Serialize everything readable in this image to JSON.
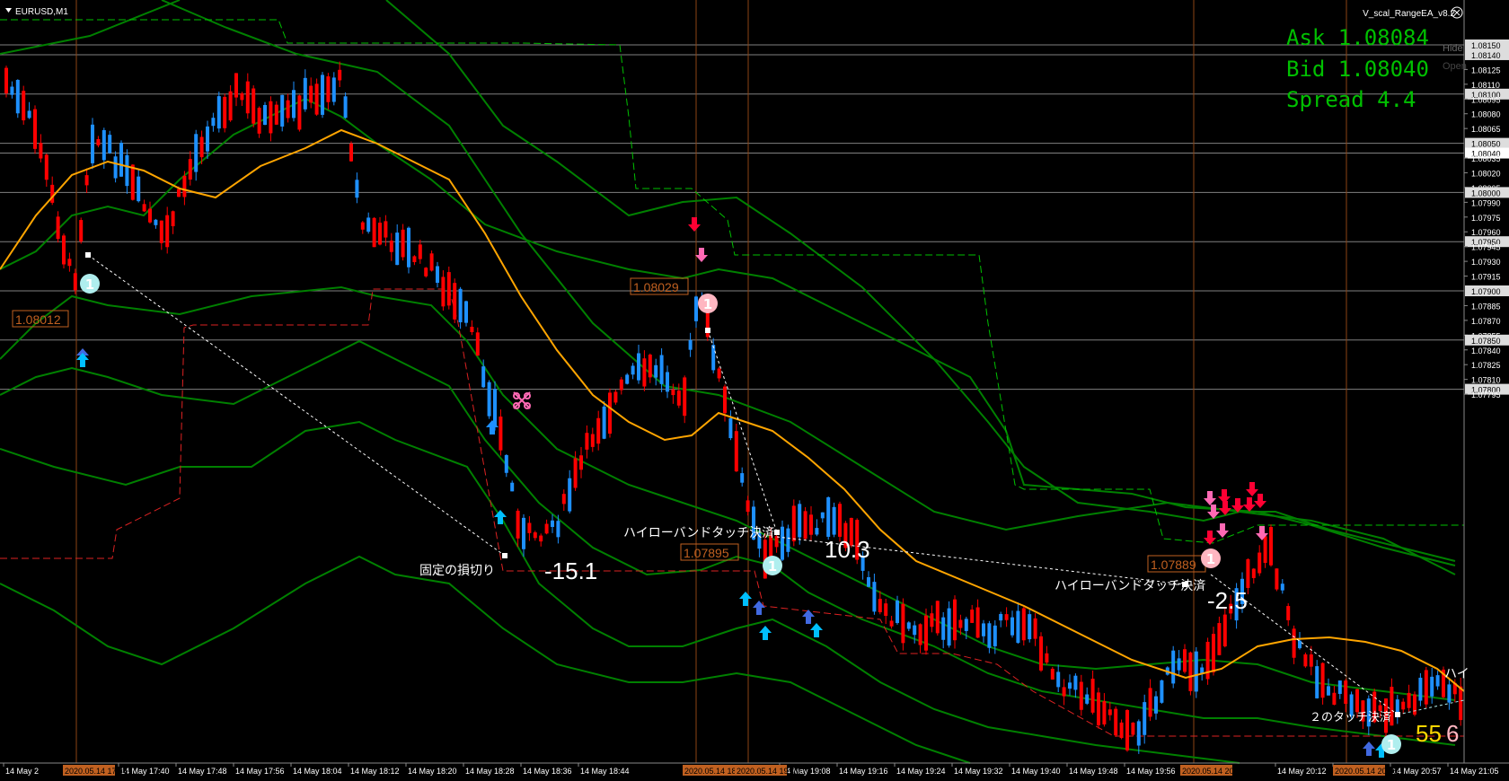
{
  "window": {
    "symbol_title": "EURUSD,M1",
    "ea_label": "V_scal_RangeEA_v8.2"
  },
  "chart_data": {
    "type": "candlestick",
    "symbol": "EURUSD",
    "timeframe": "M1",
    "ylim": [
      1.0779,
      1.0816
    ],
    "price_ticks": [
      "1.08150",
      "1.08140",
      "1.08125",
      "1.08110",
      "1.08100",
      "1.08095",
      "1.08080",
      "1.08065",
      "1.08050",
      "1.08040",
      "1.08035",
      "1.08020",
      "1.08005",
      "1.08000",
      "1.07990",
      "1.07975",
      "1.07960",
      "1.07950",
      "1.07945",
      "1.07930",
      "1.07915",
      "1.07900",
      "1.07885",
      "1.07870",
      "1.07855",
      "1.07850",
      "1.07840",
      "1.07825",
      "1.07810",
      "1.07800",
      "1.07795"
    ],
    "highlighted_ticks": [
      "1.08150",
      "1.08140",
      "1.08100",
      "1.08050",
      "1.08040",
      "1.08000",
      "1.07950",
      "1.07900",
      "1.07850",
      "1.07800"
    ],
    "time_ticks": [
      "14 May 2",
      "14 May 17:40",
      "14 May 17:48",
      "14 May 17:56",
      "14 May 18:04",
      "14 May 18:12",
      "14 May 18:20",
      "14 May 18:28",
      "14 May 18:36",
      "14 May 18:44",
      "14 May 19:08",
      "14 May 19:16",
      "14 May 19:24",
      "14 May 19:32",
      "14 May 19:40",
      "14 May 19:48",
      "14 May 19:56",
      "14 May 20:12",
      "14 May 20:41",
      "14 May 20:57",
      "14 May 21:05"
    ],
    "time_markers": [
      "2020.05.14 17:34",
      "2020.05.14 18:55",
      "2020.05.14 19:07",
      "2020.05.14 20:21",
      "2020.05.14 20:55"
    ]
  },
  "info": {
    "ask": "Ask 1.08084",
    "bid": "Bid 1.08040",
    "spread": "Spread 4.4",
    "hide": "Hide",
    "open": "Open"
  },
  "labels": {
    "price_1": "1.08012",
    "price_2": "1.08029",
    "price_3": "1.07895",
    "price_4": "1.07889",
    "fixed_stop": "固定の損切り",
    "hilo_1": "ハイローバンドタッチ決済",
    "hilo_2": "ハイローバンドタッチ決済",
    "two_touch": "２のタッチ決済",
    "ha": "ハイ",
    "pl_1": "-15.1",
    "pl_2": "10.3",
    "pl_3": "-2.5",
    "pl_4a": "55",
    "pl_4b": "6",
    "badge": "1"
  },
  "colors": {
    "background": "#000000",
    "bull": "#1E90FF",
    "bear": "#FF0000",
    "ma": "#FFA500",
    "band": "#008000",
    "info_text": "#00C000",
    "vline": "#8B4513",
    "price_box": "#C06020"
  }
}
